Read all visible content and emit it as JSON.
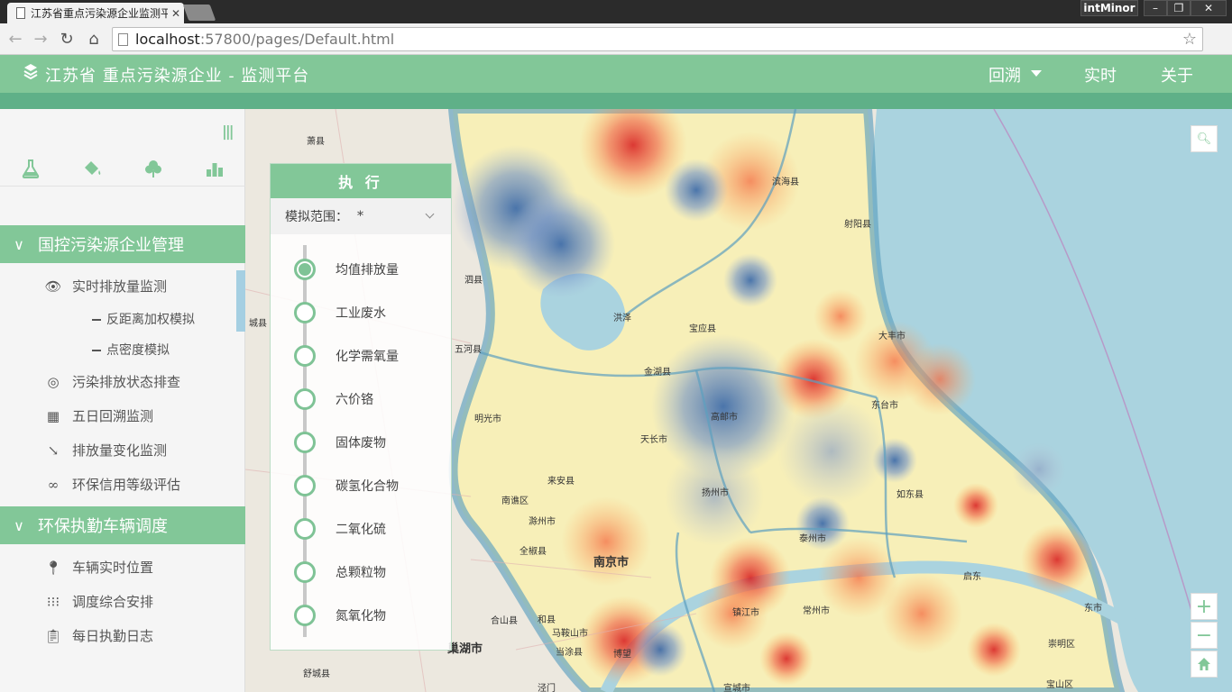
{
  "browser": {
    "tab_title": "江苏省重点污染源企业监测平台",
    "user": "intMinor",
    "url_host": "localhost",
    "url_path": ":57800/pages/Default.html"
  },
  "header": {
    "title": "江苏省 重点污染源企业 - 监测平台",
    "nav": {
      "back": "回溯",
      "realtime": "实时",
      "about": "关于"
    }
  },
  "sidebar": {
    "top_icons": [
      "flask-icon",
      "paint-bucket-icon",
      "tree-icon",
      "bar-chart-icon"
    ],
    "section1": {
      "title": "国控污染源企业管理",
      "items": [
        {
          "label": "实时排放量监测",
          "icon": "eye-icon"
        },
        {
          "label": "污染排放状态排查",
          "icon": "target-icon"
        },
        {
          "label": "五日回溯监测",
          "icon": "calendar-icon"
        },
        {
          "label": "排放量变化监测",
          "icon": "trend-down-icon"
        },
        {
          "label": "环保信用等级评估",
          "icon": "infinity-icon"
        }
      ],
      "subitems": [
        {
          "label": "反距离加权模拟"
        },
        {
          "label": "点密度模拟"
        }
      ]
    },
    "section2": {
      "title": "环保执勤车辆调度",
      "items": [
        {
          "label": "车辆实时位置",
          "icon": "map-pin-icon"
        },
        {
          "label": "调度综合安排",
          "icon": "grid-icon"
        },
        {
          "label": "每日执勤日志",
          "icon": "clipboard-icon"
        }
      ]
    }
  },
  "panel": {
    "title": "执 行",
    "range_label": "模拟范围：",
    "range_value": "*",
    "steps": [
      {
        "label": "均值排放量",
        "active": true
      },
      {
        "label": "工业废水",
        "active": false
      },
      {
        "label": "化学需氧量",
        "active": false
      },
      {
        "label": "六价铬",
        "active": false
      },
      {
        "label": "固体废物",
        "active": false
      },
      {
        "label": "碳氢化合物",
        "active": false
      },
      {
        "label": "二氧化硫",
        "active": false
      },
      {
        "label": "总颗粒物",
        "active": false
      },
      {
        "label": "氮氧化物",
        "active": false
      }
    ]
  },
  "map": {
    "labels": [
      {
        "text": "萧县"
      },
      {
        "text": "泗县"
      },
      {
        "text": "城县"
      },
      {
        "text": "五河县"
      },
      {
        "text": "洪泽"
      },
      {
        "text": "明光市"
      },
      {
        "text": "天长市"
      },
      {
        "text": "来安县"
      },
      {
        "text": "南谯区"
      },
      {
        "text": "滁州市"
      },
      {
        "text": "全椒县"
      },
      {
        "text": "合山县"
      },
      {
        "text": "和县"
      },
      {
        "text": "马鞍山市"
      },
      {
        "text": "当涂县"
      },
      {
        "text": "巢湖市"
      },
      {
        "text": "博望"
      },
      {
        "text": "舒城县"
      },
      {
        "text": "泾门"
      },
      {
        "text": "宣城市"
      },
      {
        "text": "高邮市"
      },
      {
        "text": "宝应县"
      },
      {
        "text": "金湖县"
      },
      {
        "text": "滨海县"
      },
      {
        "text": "射阳县"
      },
      {
        "text": "大丰市"
      },
      {
        "text": "东台市"
      },
      {
        "text": "如东县"
      },
      {
        "text": "扬州市"
      },
      {
        "text": "泰州市"
      },
      {
        "text": "南京市"
      },
      {
        "text": "镇江市"
      },
      {
        "text": "常州市"
      },
      {
        "text": "崇明区"
      },
      {
        "text": "宝山区"
      },
      {
        "text": "东市"
      },
      {
        "text": "启东"
      }
    ]
  },
  "map_controls": {
    "search": "search-icon",
    "zoom_in": "+",
    "zoom_out": "−",
    "home": "home-icon"
  },
  "colors": {
    "accent": "#82c798",
    "accent_dark": "#5fb088"
  }
}
